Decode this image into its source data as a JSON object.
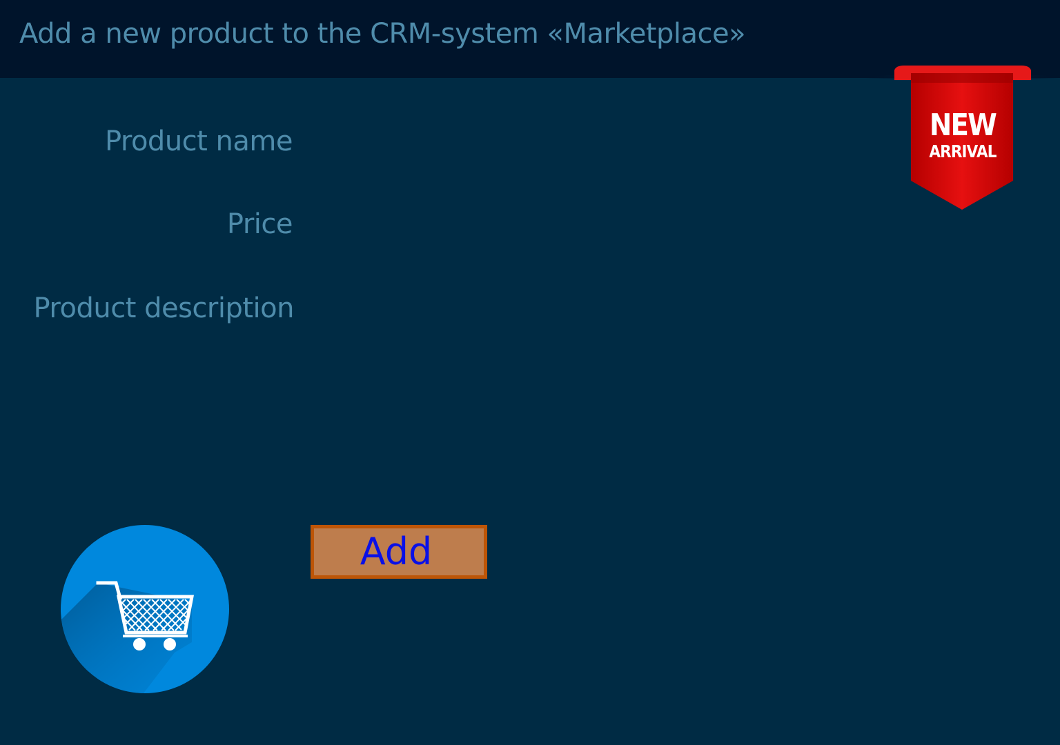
{
  "header": {
    "title": "Add a new product to the CRM-system «Marketplace»"
  },
  "form": {
    "product_name_label": "Product name",
    "product_name_value": "",
    "price_label": "Price",
    "price_value": "",
    "description_label": "Product description",
    "description_value": ""
  },
  "actions": {
    "add_label": "Add"
  },
  "badge": {
    "line1": "NEW",
    "line2": "ARRIVAL"
  },
  "icons": {
    "cart": "shopping-cart-icon",
    "badge": "ribbon-badge-icon"
  },
  "colors": {
    "background": "#002b44",
    "header_background": "#00142b",
    "label_text": "#4f8cab",
    "button_fill": "#be7d4d",
    "button_border": "#bd5507",
    "button_text": "#0a10e6",
    "cart_circle": "#0088dd",
    "badge_red": "#d90000"
  }
}
